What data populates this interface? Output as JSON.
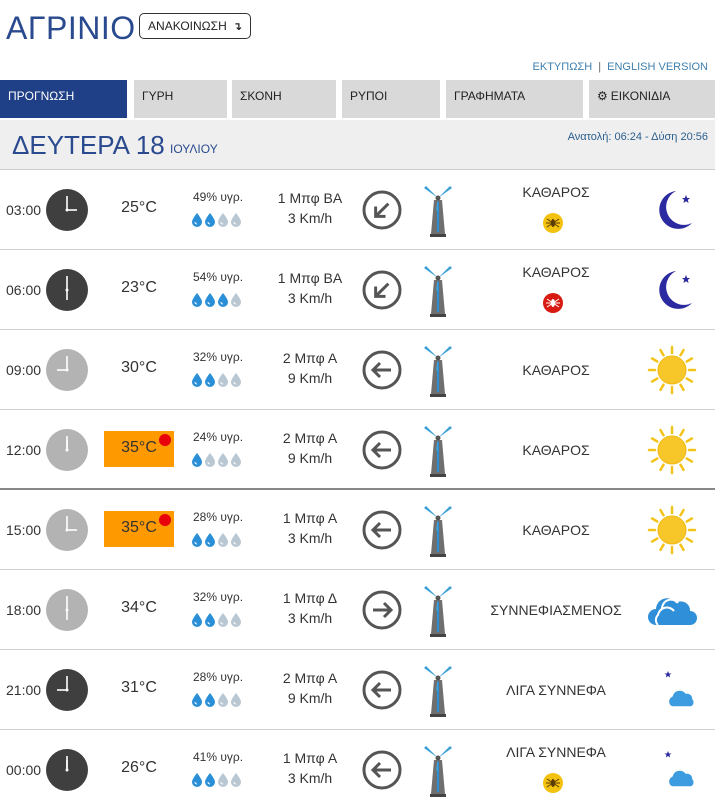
{
  "header": {
    "city": "ΑΓΡΙΝΙΟ",
    "announce_label": "ΑΝΑΚΟΙΝΩΣΗ",
    "print_link": "ΕΚΤΥΠΩΣΗ",
    "separator": "|",
    "english_link": "ENGLISH VERSION"
  },
  "tabs": [
    {
      "label": "ΠΡΟΓΝΩΣΗ",
      "active": true
    },
    {
      "label": "ΓΥΡΗ",
      "active": false
    },
    {
      "label": "ΣΚΟΝΗ",
      "active": false
    },
    {
      "label": "ΡΥΠΟΙ",
      "active": false
    },
    {
      "label": "ΓΡΑΦΗΜΑΤΑ",
      "active": false
    },
    {
      "label": "ΕΙΚΟΝΙΔΙΑ",
      "active": false,
      "icon": "gear-icon"
    }
  ],
  "day": {
    "name": "ΔΕΥΤΕΡΑ 18",
    "month": "ΙΟΥΛΙΟΥ",
    "sun_info": "Ανατολή: 06:24 - Δύση 20:56"
  },
  "colors": {
    "primary": "#2a4a8f",
    "tab_active": "#1f3f86",
    "hot": "#ff9900",
    "hot_dot": "#e8000b",
    "drop_on": "#2a8fd6",
    "drop_off": "#b9c7d3"
  },
  "forecast": [
    {
      "time": "03:00",
      "clock": "dark",
      "temp": "25°C",
      "hot": false,
      "humidity": "49% υγρ.",
      "drops": 2,
      "wind_bf": "1 Μπφ ΒΑ",
      "wind_kmh": "3 Km/h",
      "wind_dir": "down-left",
      "sky": "ΚΑΘΑΡΟΣ",
      "badge": "mosquito-yellow",
      "icon": "moon-icon"
    },
    {
      "time": "06:00",
      "clock": "dark",
      "temp": "23°C",
      "hot": false,
      "humidity": "54% υγρ.",
      "drops": 3,
      "wind_bf": "1 Μπφ ΒΑ",
      "wind_kmh": "3 Km/h",
      "wind_dir": "down-left",
      "sky": "ΚΑΘΑΡΟΣ",
      "badge": "mosquito-red",
      "icon": "moon-icon"
    },
    {
      "time": "09:00",
      "clock": "light",
      "temp": "30°C",
      "hot": false,
      "humidity": "32% υγρ.",
      "drops": 2,
      "wind_bf": "2 Μπφ Α",
      "wind_kmh": "9 Km/h",
      "wind_dir": "left",
      "sky": "ΚΑΘΑΡΟΣ",
      "badge": "",
      "icon": "sun-icon"
    },
    {
      "time": "12:00",
      "clock": "light",
      "temp": "35°C",
      "hot": true,
      "humidity": "24% υγρ.",
      "drops": 1,
      "wind_bf": "2 Μπφ Α",
      "wind_kmh": "9 Km/h",
      "wind_dir": "left",
      "sky": "ΚΑΘΑΡΟΣ",
      "badge": "",
      "icon": "sun-icon"
    },
    {
      "time": "15:00",
      "clock": "light",
      "temp": "35°C",
      "hot": true,
      "humidity": "28% υγρ.",
      "drops": 2,
      "wind_bf": "1 Μπφ Α",
      "wind_kmh": "3 Km/h",
      "wind_dir": "left",
      "sky": "ΚΑΘΑΡΟΣ",
      "badge": "",
      "icon": "sun-icon"
    },
    {
      "time": "18:00",
      "clock": "light",
      "temp": "34°C",
      "hot": false,
      "humidity": "32% υγρ.",
      "drops": 2,
      "wind_bf": "1 Μπφ Δ",
      "wind_kmh": "3 Km/h",
      "wind_dir": "right",
      "sky": "ΣΥΝΝΕΦΙΑΣΜΕΝΟΣ",
      "badge": "",
      "icon": "cloud-icon"
    },
    {
      "time": "21:00",
      "clock": "dark",
      "temp": "31°C",
      "hot": false,
      "humidity": "28% υγρ.",
      "drops": 2,
      "wind_bf": "2 Μπφ Α",
      "wind_kmh": "9 Km/h",
      "wind_dir": "left",
      "sky": "ΛΙΓΑ ΣΥΝΝΕΦΑ",
      "badge": "",
      "icon": "moon-cloud-icon"
    },
    {
      "time": "00:00",
      "clock": "dark",
      "temp": "26°C",
      "hot": false,
      "humidity": "41% υγρ.",
      "drops": 2,
      "wind_bf": "1 Μπφ Α",
      "wind_kmh": "3 Km/h",
      "wind_dir": "left",
      "sky": "ΛΙΓΑ ΣΥΝΝΕΦΑ",
      "badge": "mosquito-yellow",
      "icon": "moon-cloud-icon"
    }
  ]
}
